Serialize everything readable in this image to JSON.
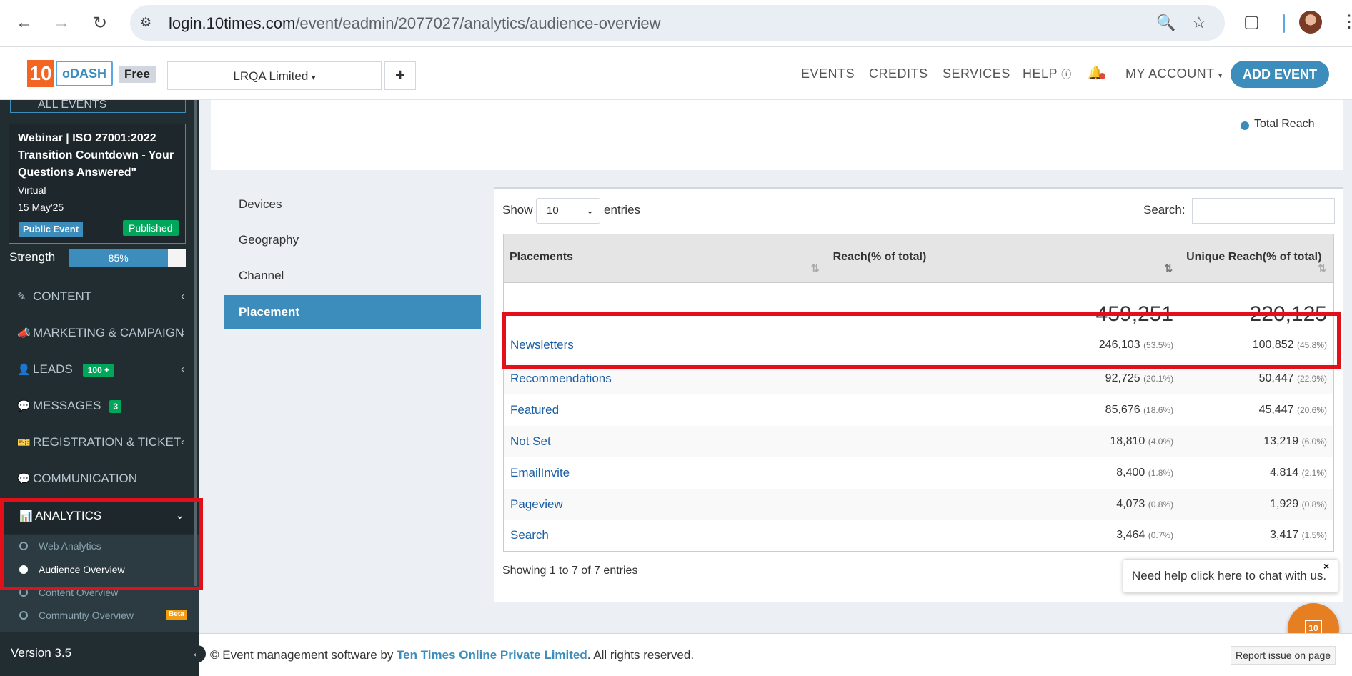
{
  "browser": {
    "url_host": "login.10times.com",
    "url_path": "/event/eadmin/2077027/analytics/audience-overview"
  },
  "header": {
    "logo_number": "10",
    "logo_text": "oDASH",
    "plan_badge": "Free",
    "org_select": "LRQA Limited",
    "add_button": "+",
    "nav": [
      "EVENTS",
      "CREDITS",
      "SERVICES",
      "HELP",
      "MY ACCOUNT"
    ],
    "add_event": "ADD EVENT"
  },
  "sidebar": {
    "all_events": "ALL EVENTS",
    "event": {
      "title": "Webinar | ISO 27001:2022 Transition Countdown - Your Questions Answered\"",
      "venue": "Virtual",
      "date": "15 May'25",
      "type_badge": "Public Event",
      "status_badge": "Published"
    },
    "strength": {
      "label": "Strength",
      "value": 85,
      "text": "85%"
    },
    "menu": [
      {
        "label": "CONTENT"
      },
      {
        "label": "MARKETING & CAMPAIGN"
      },
      {
        "label": "LEADS",
        "badge": "100 +"
      },
      {
        "label": "MESSAGES",
        "badge": "3"
      },
      {
        "label": "REGISTRATION & TICKET"
      },
      {
        "label": "COMMUNICATION"
      },
      {
        "label": "ANALYTICS"
      }
    ],
    "analytics_sub": [
      {
        "label": "Web Analytics"
      },
      {
        "label": "Audience Overview"
      },
      {
        "label": "Content Overview"
      },
      {
        "label": "Communtiy Overview",
        "badge": "Beta"
      }
    ],
    "version": "Version 3.5"
  },
  "chart_legend": {
    "label": "Total Reach",
    "color": "#3c8dbc"
  },
  "tabs": [
    "Devices",
    "Geography",
    "Channel",
    "Placement"
  ],
  "table": {
    "show_label": "Show",
    "page_size": "10",
    "entries_label": "entries",
    "search_label": "Search:",
    "headers": [
      "Placements",
      "Reach(% of total)",
      "Unique Reach(% of total)"
    ],
    "totals": [
      "459,251",
      "220,125"
    ],
    "rows": [
      {
        "placement": "Newsletters",
        "reach": "246,103",
        "reach_pct": "(53.5%)",
        "unique": "100,852",
        "unique_pct": "(45.8%)"
      },
      {
        "placement": "Recommendations",
        "reach": "92,725",
        "reach_pct": "(20.1%)",
        "unique": "50,447",
        "unique_pct": "(22.9%)"
      },
      {
        "placement": "Featured",
        "reach": "85,676",
        "reach_pct": "(18.6%)",
        "unique": "45,447",
        "unique_pct": "(20.6%)"
      },
      {
        "placement": "Not Set",
        "reach": "18,810",
        "reach_pct": "(4.0%)",
        "unique": "13,219",
        "unique_pct": "(6.0%)"
      },
      {
        "placement": "EmailInvite",
        "reach": "8,400",
        "reach_pct": "(1.8%)",
        "unique": "4,814",
        "unique_pct": "(2.1%)"
      },
      {
        "placement": "Pageview",
        "reach": "4,073",
        "reach_pct": "(0.8%)",
        "unique": "1,929",
        "unique_pct": "(0.8%)"
      },
      {
        "placement": "Search",
        "reach": "3,464",
        "reach_pct": "(0.7%)",
        "unique": "3,417",
        "unique_pct": "(1.5%)"
      }
    ],
    "info": "Showing 1 to 7 of 7 entries"
  },
  "chat": {
    "tip": "Need help click here to chat with us.",
    "close": "×",
    "icon_text": "10"
  },
  "footer": {
    "prefix": "© Event management software by ",
    "company": "Ten Times Online Private Limited",
    "suffix": ". All rights reserved.",
    "report": "Report issue on page"
  }
}
